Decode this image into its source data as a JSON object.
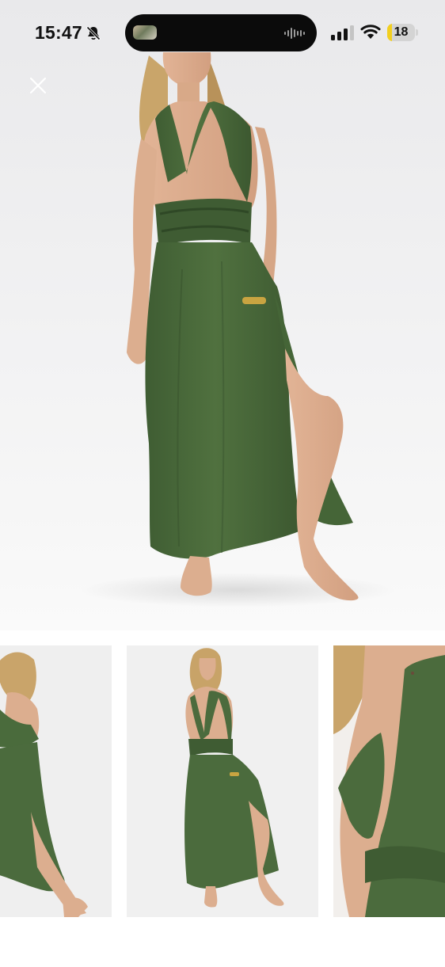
{
  "status_bar": {
    "time": "15:47",
    "battery_level": "18",
    "battery_fraction": 0.18,
    "icons": [
      "bell-slash-icon",
      "dynamic-island-media-icon",
      "audio-waveform-icon",
      "cellular-signal-icon",
      "wifi-icon",
      "battery-icon"
    ]
  },
  "viewer": {
    "close_icon": "close-icon",
    "selected_index": 1,
    "thumbnails": [
      {
        "view": "back"
      },
      {
        "view": "front"
      },
      {
        "view": "detail"
      }
    ]
  },
  "colors": {
    "dress_green": "#4b6b3d",
    "selected_border": "#f07f1a",
    "battery_fill": "#f2cf1f",
    "backdrop": "#f0f0f0"
  }
}
